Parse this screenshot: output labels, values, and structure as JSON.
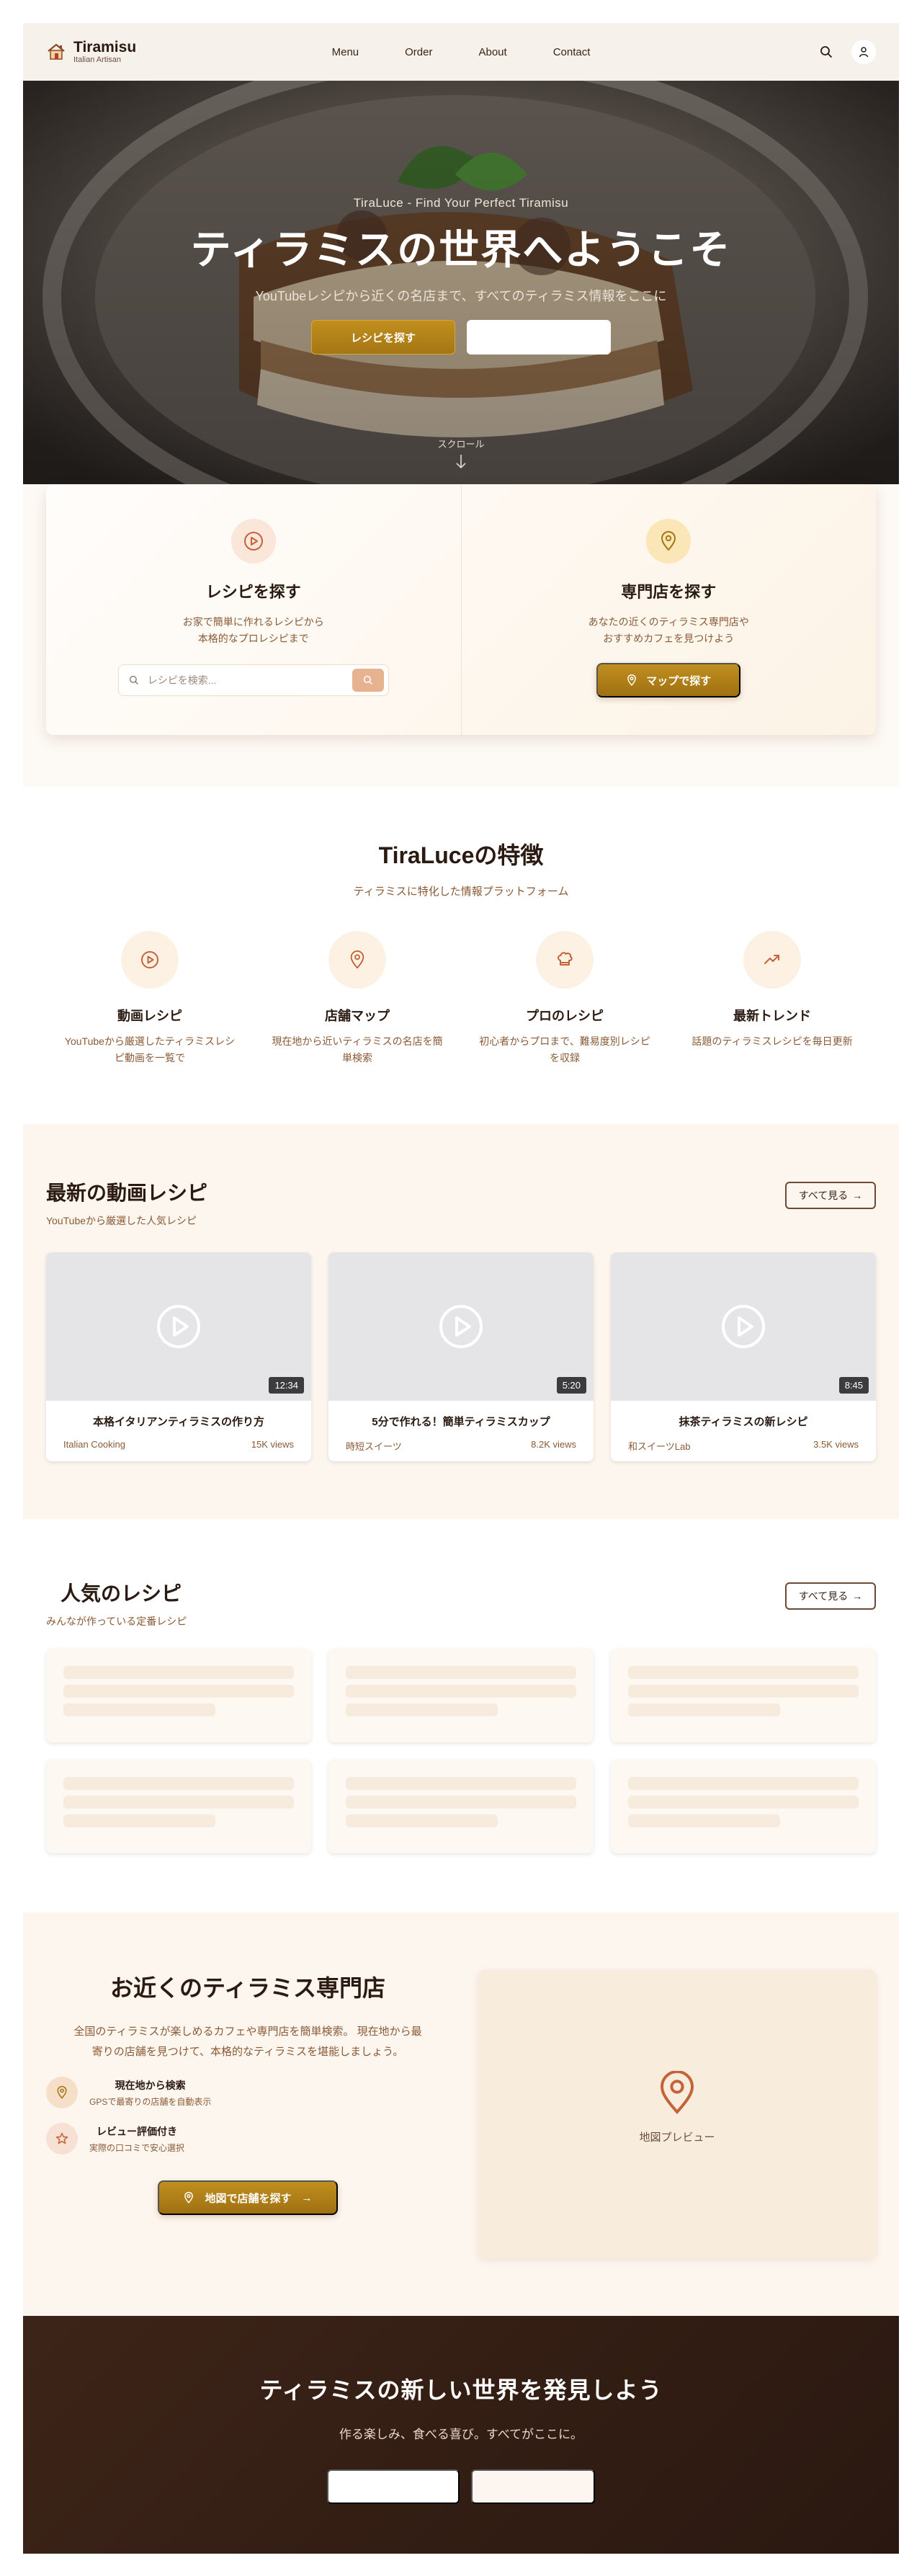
{
  "header": {
    "brand": "Tiramisu",
    "tagline": "Italian Artisan",
    "nav": [
      "Menu",
      "Order",
      "About",
      "Contact"
    ],
    "icons": [
      "search-icon",
      "user-icon"
    ]
  },
  "hero": {
    "kicker": "TiraLuce - Find Your Perfect Tiramisu",
    "title": "ティラミスの世界へようこそ",
    "subtitle": "YouTubeレシピから近くの名店まで、すべてのティラミス情報をここに",
    "primary_button": "レシピを探す",
    "secondary_button": "",
    "scroll_label": "スクロール"
  },
  "finder": {
    "recipe": {
      "title": "レシピを探す",
      "desc_line1": "お家で簡単に作れるレシピから",
      "desc_line2": "本格的なプロレシピまで",
      "search_placeholder": "レシピを検索..."
    },
    "store": {
      "title": "専門店を探す",
      "desc_line1": "あなたの近くのティラミス専門店や",
      "desc_line2": "おすすめカフェを見つけよう",
      "button": "マップで探す"
    }
  },
  "features": {
    "title": "TiraLuceの特徴",
    "subtitle": "ティラミスに特化した情報プラットフォーム",
    "items": [
      {
        "icon": "play-icon",
        "title": "動画レシピ",
        "desc_line1": "YouTubeから厳選したティラミスレシ",
        "desc_line2": "ピ動画を一覧で"
      },
      {
        "icon": "map-pin-icon",
        "title": "店舗マップ",
        "desc_line1": "現在地から近いティラミスの名店を簡",
        "desc_line2": "単検索"
      },
      {
        "icon": "chef-hat-icon",
        "title": "プロのレシピ",
        "desc_line1": "初心者からプロまで、難易度別レシピ",
        "desc_line2": "を収録"
      },
      {
        "icon": "trending-icon",
        "title": "最新トレンド",
        "desc_line1": "話題のティラミスレシピを毎日更新",
        "desc_line2": ""
      }
    ]
  },
  "videos": {
    "title": "最新の動画レシピ",
    "subtitle": "YouTubeから厳選した人気レシピ",
    "see_all": "すべて見る",
    "items": [
      {
        "duration": "12:34",
        "title": "本格イタリアンティラミスの作り方",
        "channel": "Italian Cooking",
        "views": "15K views"
      },
      {
        "duration": "5:20",
        "title": "5分で作れる！簡単ティラミスカップ",
        "channel": "時短スイーツ",
        "views": "8.2K views"
      },
      {
        "duration": "8:45",
        "title": "抹茶ティラミスの新レシピ",
        "channel": "和スイーツLab",
        "views": "3.5K views"
      }
    ]
  },
  "popular": {
    "title": "人気のレシピ",
    "subtitle": "みんなが作っている定番レシピ",
    "see_all": "すべて見る"
  },
  "stores": {
    "title": "お近くのティラミス専門店",
    "desc_line1": "全国のティラミスが楽しめるカフェや専門店を簡単検索。 現在地から最",
    "desc_line2": "寄りの店舗を見つけて、本格的なティラミスを堪能しましょう。",
    "feature1_title": "現在地から検索",
    "feature1_desc": "GPSで最寄りの店舗を自動表示",
    "feature2_title": "レビュー評価付き",
    "feature2_desc": "実際の口コミで安心選択",
    "button": "地図で店舗を探す",
    "map_label": "地図プレビュー"
  },
  "cta": {
    "title": "ティラミスの新しい世界を発見しよう",
    "subtitle": "作る楽しみ、食べる喜び。すべてがここに。"
  },
  "colors": {
    "accent_gold": "#b3841a",
    "dark_brown": "#2a1810",
    "cream": "#fcf6ee",
    "text_brown": "#8a5a36"
  }
}
